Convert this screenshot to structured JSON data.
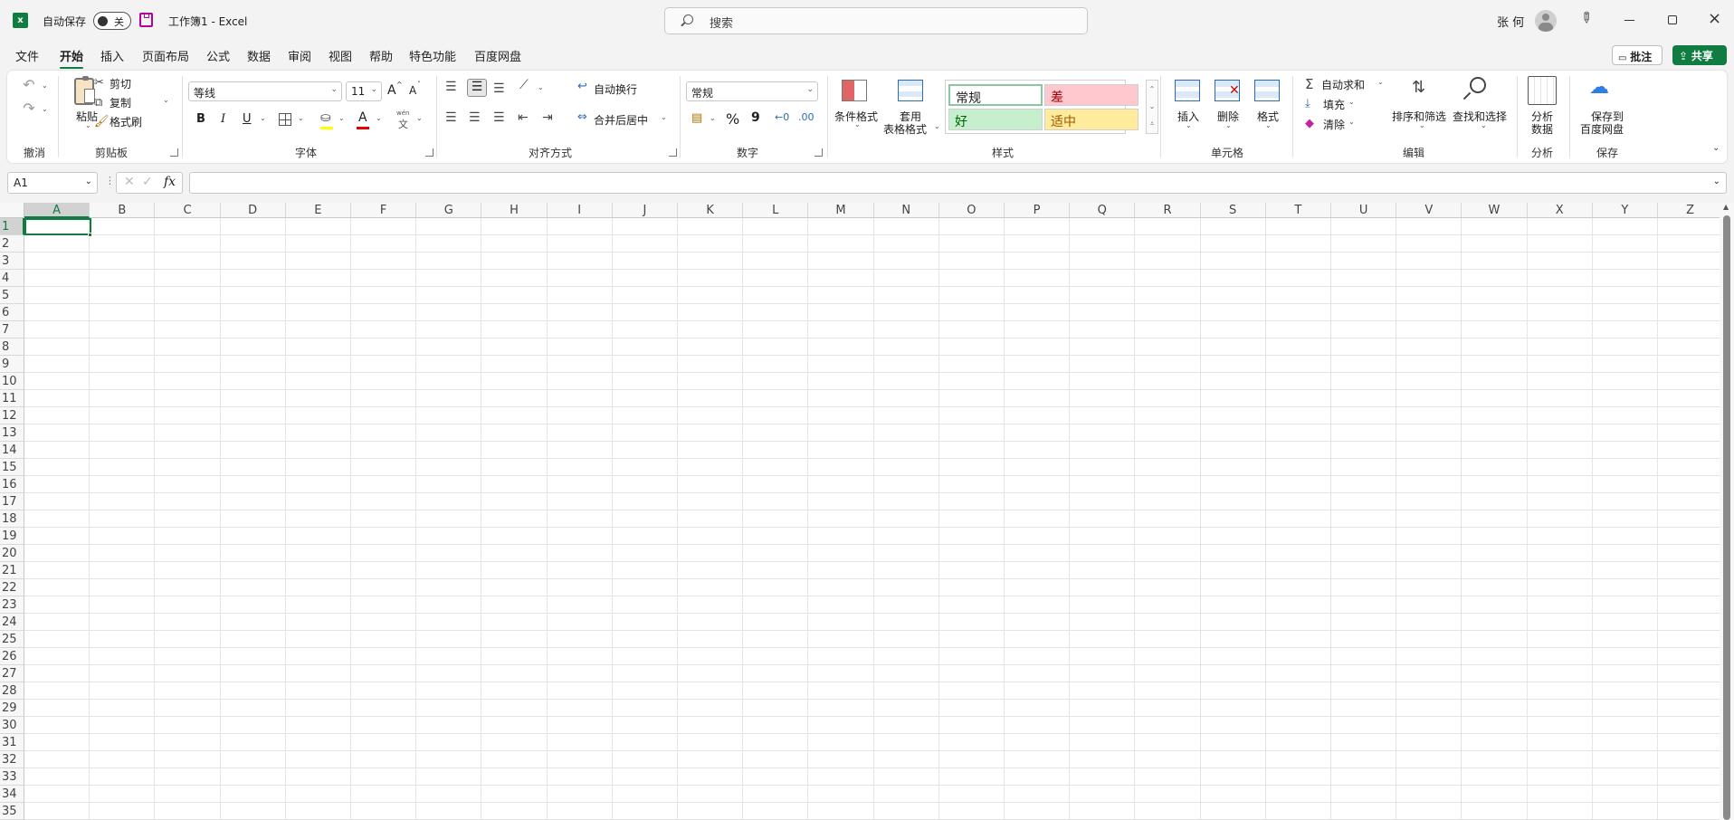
{
  "titlebar": {
    "autosave_label": "自动保存",
    "autosave_state": "关",
    "doc_title": "工作簿1  -  Excel",
    "search_placeholder": "搜索",
    "user_name": "张 何"
  },
  "tabs": [
    "文件",
    "开始",
    "插入",
    "页面布局",
    "公式",
    "数据",
    "审阅",
    "视图",
    "帮助",
    "特色功能",
    "百度网盘"
  ],
  "actions": {
    "comment": "批注",
    "share": "共享"
  },
  "ribbon": {
    "undo_group": "撤消",
    "clipboard": {
      "paste": "粘贴",
      "cut": "剪切",
      "copy": "复制",
      "format_painter": "格式刷",
      "label": "剪贴板"
    },
    "font": {
      "name": "等线",
      "size": "11",
      "label": "字体",
      "bold": "B",
      "italic": "I",
      "underline": "U",
      "grow": "A",
      "shrink": "A",
      "color_letter": "A",
      "wen": "wén",
      "wen_char": "文"
    },
    "alignment": {
      "wrap": "自动换行",
      "merge": "合并后居中",
      "label": "对齐方式"
    },
    "number": {
      "format": "常规",
      "label": "数字",
      "percent": "%",
      "comma": "9"
    },
    "styles": {
      "cond": "条件格式",
      "table_1": "套用",
      "table_2": "表格格式",
      "normal": "常规",
      "bad": "差",
      "good": "好",
      "neutral": "适中",
      "label": "样式"
    },
    "cells": {
      "insert": "插入",
      "delete": "删除",
      "format": "格式",
      "label": "单元格"
    },
    "editing": {
      "autosum": "自动求和",
      "fill": "填充",
      "clear": "清除",
      "sort": "排序和筛选",
      "find": "查找和选择",
      "label": "编辑"
    },
    "analysis": {
      "btn1": "分析",
      "btn2": "数据",
      "label": "分析"
    },
    "save": {
      "btn1": "保存到",
      "btn2": "百度网盘",
      "label": "保存"
    }
  },
  "formula_bar": {
    "name_box": "A1",
    "fx": "fx",
    "value": ""
  },
  "grid": {
    "columns": [
      "A",
      "B",
      "C",
      "D",
      "E",
      "F",
      "G",
      "H",
      "I",
      "J",
      "K",
      "L",
      "M",
      "N",
      "O",
      "P",
      "Q",
      "R",
      "S",
      "T",
      "U",
      "V",
      "W",
      "X",
      "Y",
      "Z"
    ],
    "rows": [
      "1",
      "2",
      "3",
      "4",
      "5",
      "6",
      "7",
      "8",
      "9",
      "10",
      "11",
      "12",
      "13",
      "14",
      "15",
      "16",
      "17",
      "18",
      "19",
      "20",
      "21",
      "22",
      "23",
      "24",
      "25",
      "26",
      "27",
      "28",
      "29",
      "30",
      "31",
      "32",
      "33",
      "34",
      "35"
    ],
    "active_cell": "A1"
  },
  "colors": {
    "accent": "#107c41",
    "bad_bg": "#ffc7ce",
    "bad_fg": "#9c0006",
    "good_bg": "#c6efce",
    "good_fg": "#006100",
    "neutral_bg": "#ffeb9c",
    "neutral_fg": "#9c5700"
  }
}
